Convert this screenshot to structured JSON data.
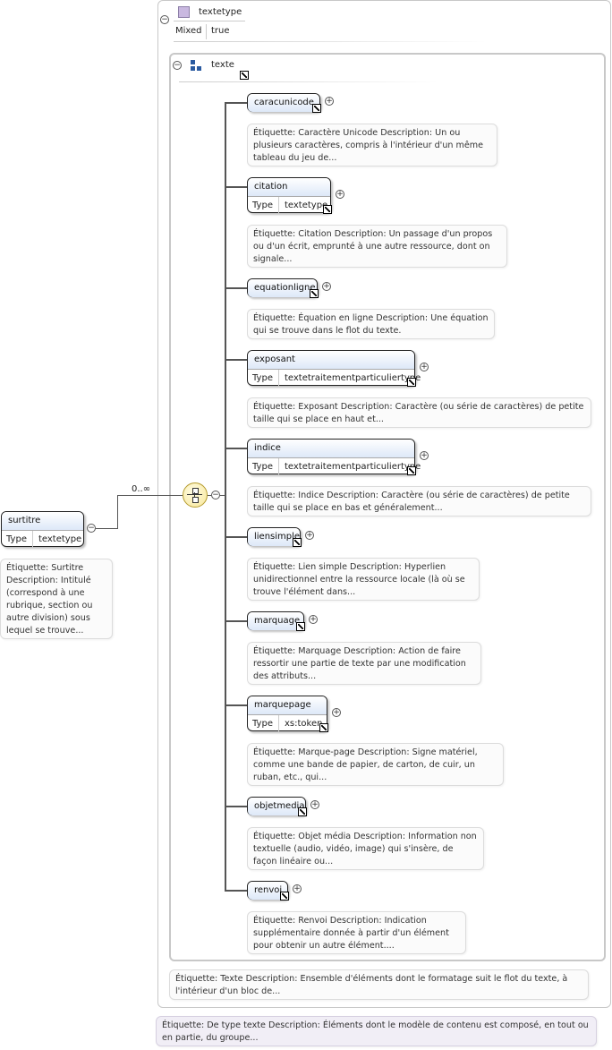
{
  "outer_type": {
    "name": "textetype",
    "attr_key": "Mixed",
    "attr_val": "true",
    "annotation": "Étiquette: De type texte Description: Éléments dont le modèle de contenu est composé, en tout ou en partie, du groupe..."
  },
  "group": {
    "name": "texte",
    "annotation": "Étiquette: Texte Description: Ensemble d'éléments dont le formatage suit le flot du texte, à l'intérieur d'un bloc de..."
  },
  "root": {
    "name": "surtitre",
    "type_key": "Type",
    "type_val": "textetype",
    "annotation": "Étiquette: Surtitre Description: Intitulé (correspond à une rubrique, section ou autre division) sous lequel se trouve...",
    "cardinality": "0..∞"
  },
  "elements": [
    {
      "name": "caracunicode",
      "annotation": "Étiquette: Caractère Unicode Description: Un ou plusieurs caractères, compris à l'intérieur d'un même tableau du jeu de..."
    },
    {
      "name": "citation",
      "type_key": "Type",
      "type_val": "textetype",
      "annotation": "Étiquette: Citation Description: Un passage d'un propos ou d'un écrit, emprunté à une autre ressource, dont on signale..."
    },
    {
      "name": "equationligne",
      "annotation": "Étiquette: Équation en ligne Description: Une équation qui se trouve dans le flot du texte."
    },
    {
      "name": "exposant",
      "type_key": "Type",
      "type_val": "textetraitementparticuliertype",
      "annotation": "Étiquette: Exposant Description: Caractère (ou série de caractères) de petite taille qui se place en haut et..."
    },
    {
      "name": "indice",
      "type_key": "Type",
      "type_val": "textetraitementparticuliertype",
      "annotation": "Étiquette: Indice Description: Caractère (ou série de caractères) de petite taille qui se place en bas et généralement..."
    },
    {
      "name": "liensimple",
      "annotation": "Étiquette: Lien simple Description: Hyperlien unidirectionnel entre la ressource locale (là où se trouve l'élément dans..."
    },
    {
      "name": "marquage",
      "annotation": "Étiquette: Marquage Description: Action de faire ressortir une partie de texte par une modification des attributs..."
    },
    {
      "name": "marquepage",
      "type_key": "Type",
      "type_val": "xs:token",
      "annotation": "Étiquette: Marque-page Description: Signe matériel, comme une bande de papier, de carton, de cuir, un ruban, etc., qui..."
    },
    {
      "name": "objetmedia",
      "annotation": "Étiquette: Objet média Description: Information non textuelle (audio, vidéo, image) qui s'insère, de façon linéaire ou..."
    },
    {
      "name": "renvoi",
      "annotation": "Étiquette: Renvoi Description: Indication supplémentaire donnée à partir d'un élément pour obtenir un autre élément...."
    }
  ],
  "icons": [
    "type-icon",
    "group-icon",
    "choice-compositor-icon",
    "link-arrow-icon",
    "expand-icon",
    "collapse-icon"
  ],
  "colors": {
    "element_header": "#dde8f8",
    "type_icon": "#c9b8e0",
    "compositor": "#fff6c8"
  }
}
